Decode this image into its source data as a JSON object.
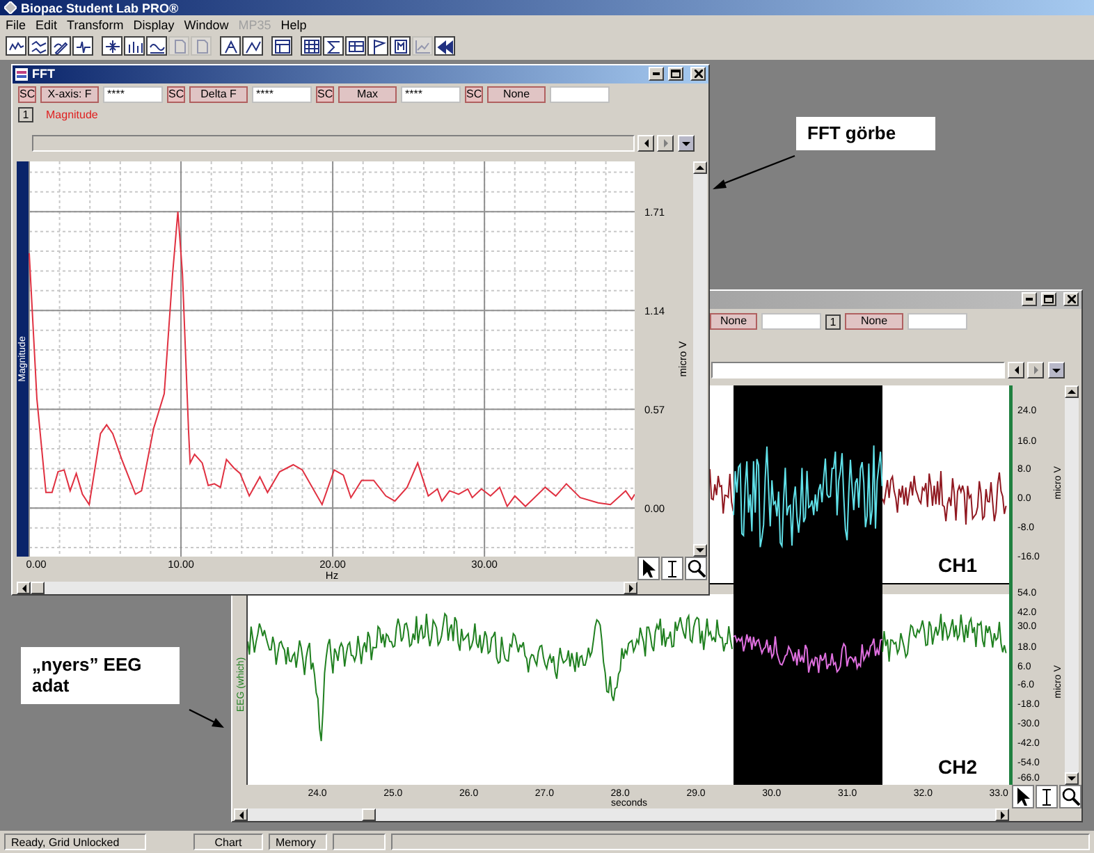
{
  "window": {
    "title": "Biopac Student Lab PRO®"
  },
  "menu": [
    {
      "label": "File",
      "disabled": false
    },
    {
      "label": "Edit",
      "disabled": false
    },
    {
      "label": "Transform",
      "disabled": false
    },
    {
      "label": "Display",
      "disabled": false
    },
    {
      "label": "Window",
      "disabled": false
    },
    {
      "label": "MP35",
      "disabled": true
    },
    {
      "label": "Help",
      "disabled": false
    }
  ],
  "toolbar": [
    {
      "disabled": false
    },
    {
      "disabled": false
    },
    {
      "disabled": false
    },
    {
      "disabled": false
    },
    {
      "disabled": false
    },
    {
      "disabled": false
    },
    {
      "disabled": false
    },
    {
      "disabled": true
    },
    {
      "disabled": true
    },
    {
      "disabled": false
    },
    {
      "disabled": false
    },
    {
      "disabled": false
    },
    {
      "disabled": false
    },
    {
      "disabled": false
    },
    {
      "disabled": false
    },
    {
      "disabled": false
    },
    {
      "disabled": false
    },
    {
      "disabled": true
    },
    {
      "disabled": false
    }
  ],
  "fft_window": {
    "title": "FFT",
    "measurements": [
      {
        "channel": "SC",
        "function": "X-axis: F",
        "value": "****"
      },
      {
        "channel": "SC",
        "function": "Delta F",
        "value": "****"
      },
      {
        "channel": "SC",
        "function": "Max",
        "value": "****"
      },
      {
        "channel": "SC",
        "function": "None"
      }
    ],
    "channel_number": "1",
    "channel_label": "Magnitude",
    "strip_label": "Magnitude",
    "chart_data": {
      "type": "line",
      "grid": true,
      "xlabel": "Hz",
      "ylabel": "micro V",
      "xlim": [
        0,
        39.9
      ],
      "ylim": [
        -0.28,
        2.0
      ],
      "xticks": [
        {
          "value": 0,
          "label": "0.00"
        },
        {
          "value": 10,
          "label": "10.00"
        },
        {
          "value": 20,
          "label": "20.00"
        },
        {
          "value": 30,
          "label": "30.00"
        }
      ],
      "yticks": [
        {
          "value": 0,
          "label": "0.00"
        },
        {
          "value": 0.57,
          "label": "0.57"
        },
        {
          "value": 1.14,
          "label": "1.14"
        },
        {
          "value": 1.71,
          "label": "1.71"
        }
      ],
      "x": [
        0,
        0.5,
        1.1,
        1.5,
        1.9,
        2.3,
        2.7,
        3.1,
        3.5,
        3.95,
        4.7,
        5.1,
        5.5,
        6.1,
        7.0,
        7.4,
        8.2,
        8.9,
        9.45,
        9.8,
        10.1,
        10.5,
        10.6,
        10.9,
        11.4,
        11.8,
        12.2,
        12.6,
        13.0,
        13.5,
        13.9,
        14.5,
        15.2,
        15.7,
        16.5,
        17.4,
        18.0,
        19.3,
        20.1,
        20.7,
        21.2,
        21.9,
        22.7,
        23.5,
        24.1,
        24.9,
        25.6,
        26.3,
        26.9,
        27.2,
        27.7,
        28.3,
        28.9,
        29.2,
        29.8,
        30.4,
        31.0,
        31.5,
        32.0,
        32.7,
        34.0,
        34.7,
        35.4,
        36.3,
        37.5,
        38.3,
        39.3,
        39.7,
        39.9
      ],
      "series": [
        {
          "color": "#e03040",
          "values": [
            1.47,
            0.63,
            0.09,
            0.09,
            0.21,
            0.22,
            0.1,
            0.2,
            0.08,
            0.02,
            0.43,
            0.48,
            0.43,
            0.28,
            0.08,
            0.1,
            0.46,
            0.66,
            1.35,
            1.71,
            1.35,
            0.44,
            0.26,
            0.31,
            0.26,
            0.13,
            0.14,
            0.12,
            0.28,
            0.23,
            0.2,
            0.07,
            0.18,
            0.09,
            0.21,
            0.25,
            0.22,
            0.02,
            0.22,
            0.19,
            0.06,
            0.16,
            0.16,
            0.07,
            0.04,
            0.12,
            0.26,
            0.07,
            0.11,
            0.04,
            0.1,
            0.08,
            0.11,
            0.06,
            0.11,
            0.07,
            0.12,
            0.01,
            0.07,
            0.01,
            0.12,
            0.07,
            0.14,
            0.06,
            0.03,
            0.02,
            0.1,
            0.05,
            0.08
          ]
        }
      ]
    }
  },
  "eeg_window": {
    "measurements": [
      {
        "function": "None"
      },
      {
        "channel": "1",
        "function": "None"
      }
    ],
    "channels": [
      {
        "label": "CH1",
        "unit": "micro V",
        "yticks": [
          "24.0",
          "16.0",
          "8.0",
          "0.0",
          "-8.0",
          "-16.0"
        ]
      },
      {
        "strip_label": "EEG (which)",
        "label": "CH2",
        "unit": "micro V",
        "yticks": [
          "54.0",
          "42.0",
          "30.0",
          "18.0",
          "6.0",
          "-6.0",
          "-18.0",
          "-30.0",
          "-42.0",
          "-54.0",
          "-66.0"
        ]
      }
    ],
    "xticks": [
      "24.0",
      "25.0",
      "26.0",
      "27.0",
      "28.0",
      "29.0",
      "30.0",
      "31.0",
      "32.0",
      "33.0"
    ],
    "xlabel": "seconds"
  },
  "annotations": [
    {
      "text": "FFT görbe"
    },
    {
      "text": "„nyers” EEG adat"
    }
  ],
  "status_bar": [
    "Ready, Grid Unlocked",
    "Chart",
    "Memory"
  ]
}
